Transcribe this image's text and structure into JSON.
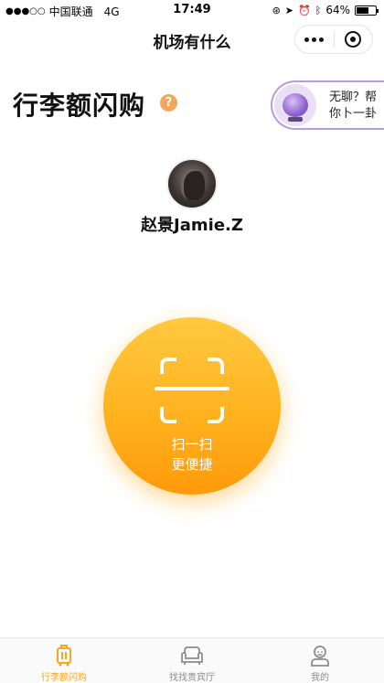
{
  "status_bar": {
    "carrier": "中国联通",
    "network": "4G",
    "time": "17:49",
    "battery": "64%",
    "battery_level": 0.64
  },
  "nav": {
    "title": "机场有什么"
  },
  "page": {
    "heading": "行李额闪购",
    "help_symbol": "?"
  },
  "fortune_banner": {
    "line1": "无聊？帮",
    "line2": "你卜一卦"
  },
  "user": {
    "name": "赵景Jamie.Z"
  },
  "scan": {
    "line1": "扫一扫",
    "line2": "更便捷"
  },
  "tabs": [
    {
      "label": "行李额闪购",
      "icon": "luggage-icon",
      "active": true
    },
    {
      "label": "找找贵宾厅",
      "icon": "sofa-icon",
      "active": false
    },
    {
      "label": "我的",
      "icon": "user-icon",
      "active": false
    }
  ],
  "colors": {
    "accent": "#f5a623",
    "scan_gradient_top": "#ffc940",
    "scan_gradient_bottom": "#ff9a0a",
    "fortune_border": "#b89be0"
  }
}
